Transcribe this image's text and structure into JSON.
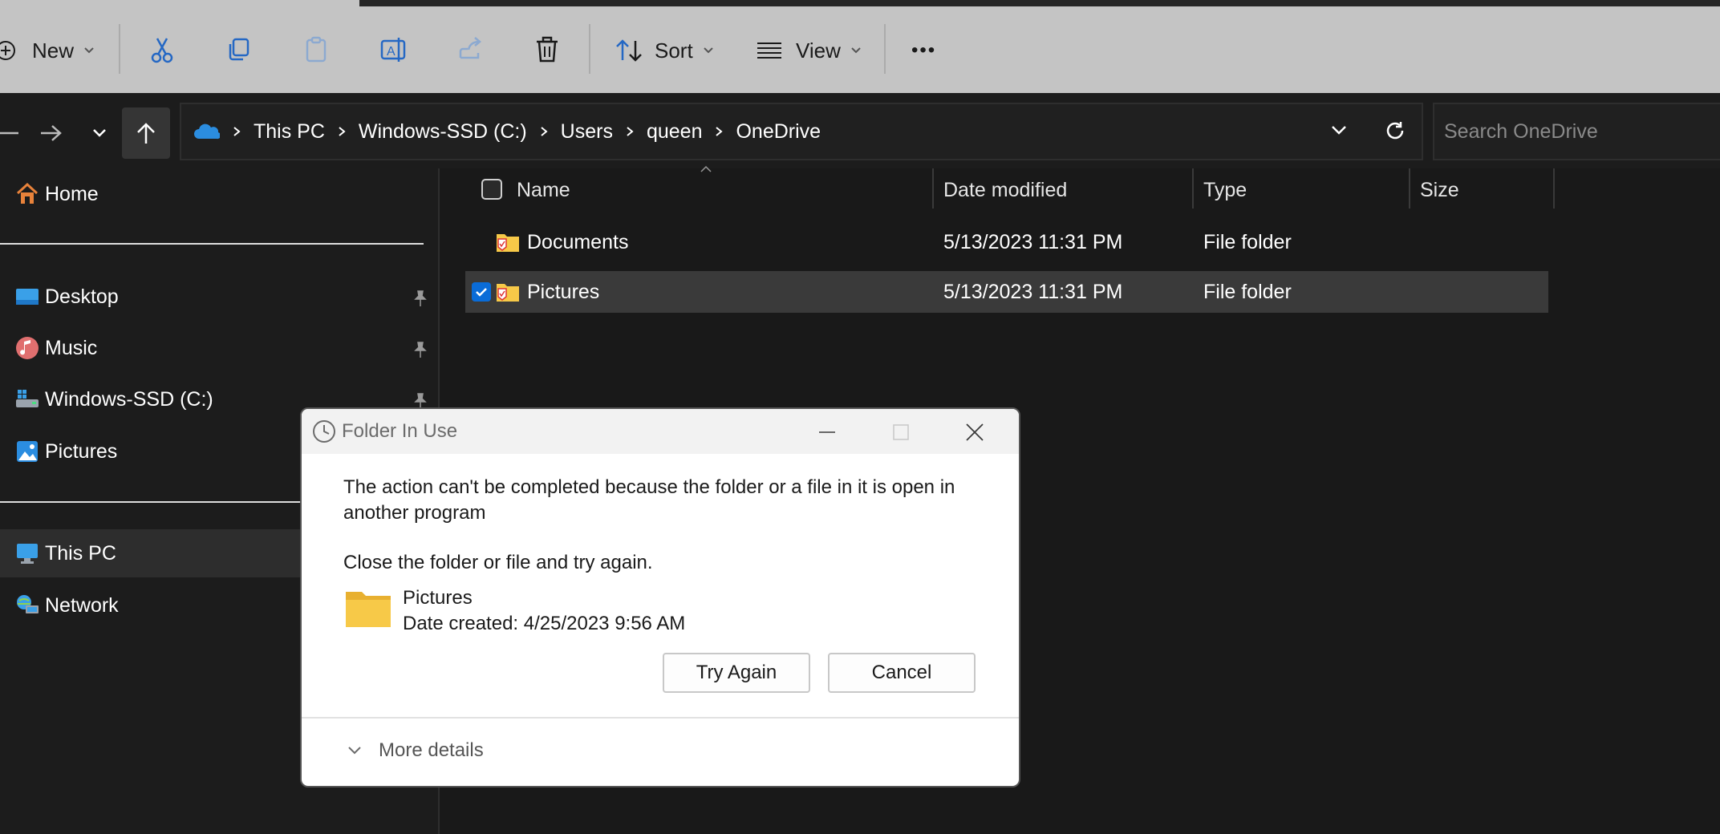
{
  "toolbar": {
    "new_label": "New",
    "sort_label": "Sort",
    "view_label": "View",
    "more_label": "•••"
  },
  "address": {
    "crumbs": [
      "This PC",
      "Windows-SSD (C:)",
      "Users",
      "queen",
      "OneDrive"
    ],
    "search_placeholder": "Search OneDrive"
  },
  "sidebar": {
    "home": "Home",
    "desktop": "Desktop",
    "music": "Music",
    "drive": "Windows-SSD (C:)",
    "pictures": "Pictures",
    "this_pc": "This PC",
    "network": "Network"
  },
  "columns": {
    "name": "Name",
    "date_modified": "Date modified",
    "type": "Type",
    "size": "Size"
  },
  "files": [
    {
      "name": "Documents",
      "date": "5/13/2023 11:31 PM",
      "type": "File folder",
      "size": ""
    },
    {
      "name": "Pictures",
      "date": "5/13/2023 11:31 PM",
      "type": "File folder",
      "size": ""
    }
  ],
  "dialog": {
    "title": "Folder In Use",
    "message": "The action can't be completed because the folder or a file in it is open in another program",
    "instruction": "Close the folder or file and try again.",
    "item_name": "Pictures",
    "item_date": "Date created: 4/25/2023 9:56 AM",
    "try_again": "Try Again",
    "cancel": "Cancel",
    "more_details": "More details"
  },
  "colors": {
    "accent": "#0a6cd8",
    "folder_yellow": "#f7c948",
    "onedrive_blue": "#2b8de0"
  }
}
